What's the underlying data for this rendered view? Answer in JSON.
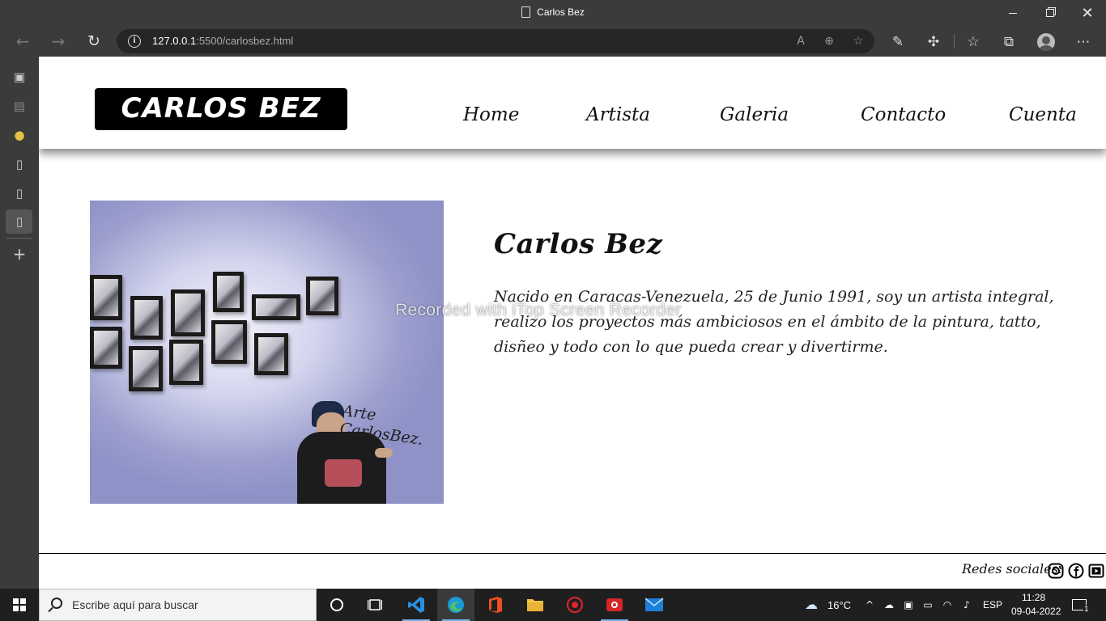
{
  "browser": {
    "window_title": "Carlos Bez",
    "url_host": "127.0.0.1",
    "url_rest": ":5500/carlosbez.html"
  },
  "site": {
    "logo": "CARLOS BEZ",
    "nav": [
      "Home",
      "Artista",
      "Galeria",
      "Contacto",
      "Cuenta"
    ],
    "artist_name": "Carlos Bez",
    "bio": "Nacido en Caracas-Venezuela, 25 de Junio 1991, soy un artista integral, realizo los proyectos más ambiciosos en el ámbito de la pintura, tatto, disñeo y todo con lo que pueda crear y divertirme.",
    "artwork_tag": "Arte\nCarlosBez.",
    "footer_social_label": "Redes sociales:",
    "social_icons": [
      "instagram-icon",
      "facebook-icon",
      "youtube-icon"
    ]
  },
  "overlay": {
    "watermark": "Recorded with iTop Screen Recorder"
  },
  "taskbar": {
    "search_placeholder": "Escribe aquí para buscar",
    "weather": "16°C",
    "language": "ESP",
    "time": "11:28",
    "date": "09-04-2022",
    "notifications": "1"
  },
  "colors": {
    "chrome_bg": "#3b3b3b",
    "page_bg": "#ffffff",
    "logo_bg": "#000000",
    "taskbar_bg": "#1f1f1f"
  }
}
